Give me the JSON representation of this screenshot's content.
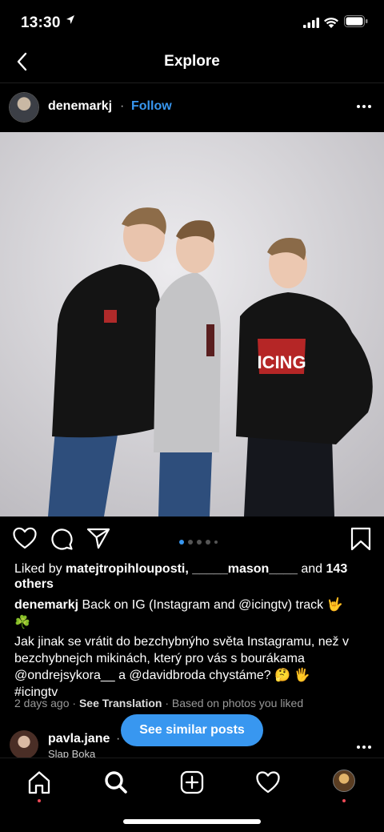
{
  "status_bar": {
    "time": "13:30"
  },
  "nav": {
    "title": "Explore"
  },
  "post": {
    "username": "denemarkj",
    "dot": "·",
    "follow_label": "Follow",
    "likes": {
      "prefix": "Liked by ",
      "user1": "matejtropihlouposti",
      "sep": ", ",
      "user2": "_____mason____",
      "and": " and ",
      "others": "143 others"
    },
    "caption": {
      "username": "denemarkj",
      "line1": " Back on IG (Instagram and @icingtv) track 🤟",
      "line2": "☘️",
      "body": "Jak jinak se vrátit do bezchybnýho světa Instagramu, než v bezchybnejch mikinách, který pro vás s bourákama @ondrejsykora__ a @davidbroda chystáme? 🤔 🖐",
      "hashtag": "#icingtv"
    },
    "meta": {
      "age": "2 days ago",
      "sep": " · ",
      "see_translation": "See Translation",
      "reason": "Based on photos you liked"
    },
    "carousel": {
      "count": 5,
      "active_index": 0
    }
  },
  "next_post": {
    "username": "pavla.jane",
    "dot": "·",
    "location": "Slap Boka"
  },
  "similar_button": {
    "label": "See similar posts"
  },
  "colors": {
    "accent": "#3897f0",
    "background": "#000000",
    "notification": "#ed4956"
  },
  "icons": {
    "back": "chevron-left-icon",
    "heart": "heart-icon",
    "comment": "comment-icon",
    "share": "paper-plane-icon",
    "save": "bookmark-icon",
    "more": "more-dots-icon",
    "home": "home-icon",
    "search": "search-icon",
    "add": "add-post-icon",
    "activity": "heart-icon",
    "profile": "avatar"
  }
}
